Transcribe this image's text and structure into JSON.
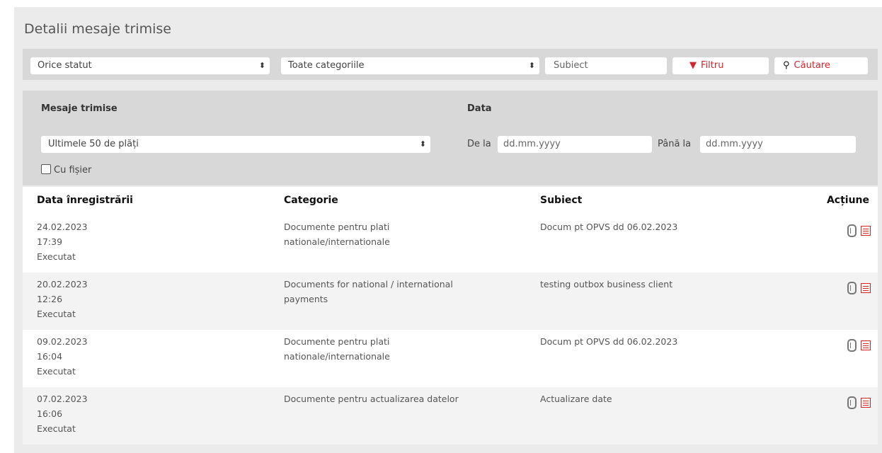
{
  "page": {
    "title": "Detalii mesaje trimise"
  },
  "toolbar": {
    "status_select": "Orice statut",
    "category_select": "Toate categoriile",
    "subject_placeholder": "Subiect",
    "filter_label": "Filtru",
    "search_label": "Căutare"
  },
  "filters": {
    "sent_label": "Mesaje trimise",
    "sent_select": "Ultimele 50 de plăți",
    "date_label": "Data",
    "from_label": "De la",
    "from_placeholder": "dd.mm.yyyy",
    "to_label": "Până la",
    "to_placeholder": "dd.mm.yyyy",
    "with_file_label": "Cu fișier"
  },
  "table": {
    "headers": [
      "Data înregistrării",
      "Categorie",
      "Subiect",
      "Acțiune"
    ],
    "rows": [
      {
        "date": "24.02.2023",
        "time": "17:39",
        "status": "Executat",
        "category": "Documente pentru plati nationale/internationale",
        "subject": "Docum pt OPVS dd 06.02.2023"
      },
      {
        "date": "20.02.2023",
        "time": "12:26",
        "status": "Executat",
        "category": "Documents for national / international payments",
        "subject": "testing outbox business client"
      },
      {
        "date": "09.02.2023",
        "time": "16:04",
        "status": "Executat",
        "category": "Documente pentru plati nationale/internationale",
        "subject": "Docum pt OPVS dd 06.02.2023"
      },
      {
        "date": "07.02.2023",
        "time": "16:06",
        "status": "Executat",
        "category": "Documente pentru actualizarea datelor",
        "subject": "Actualizare date"
      }
    ]
  },
  "colors": {
    "accent": "#d2262c",
    "panel_bg": "#ebebeb",
    "toolbar_bg": "#d8d8d8"
  }
}
